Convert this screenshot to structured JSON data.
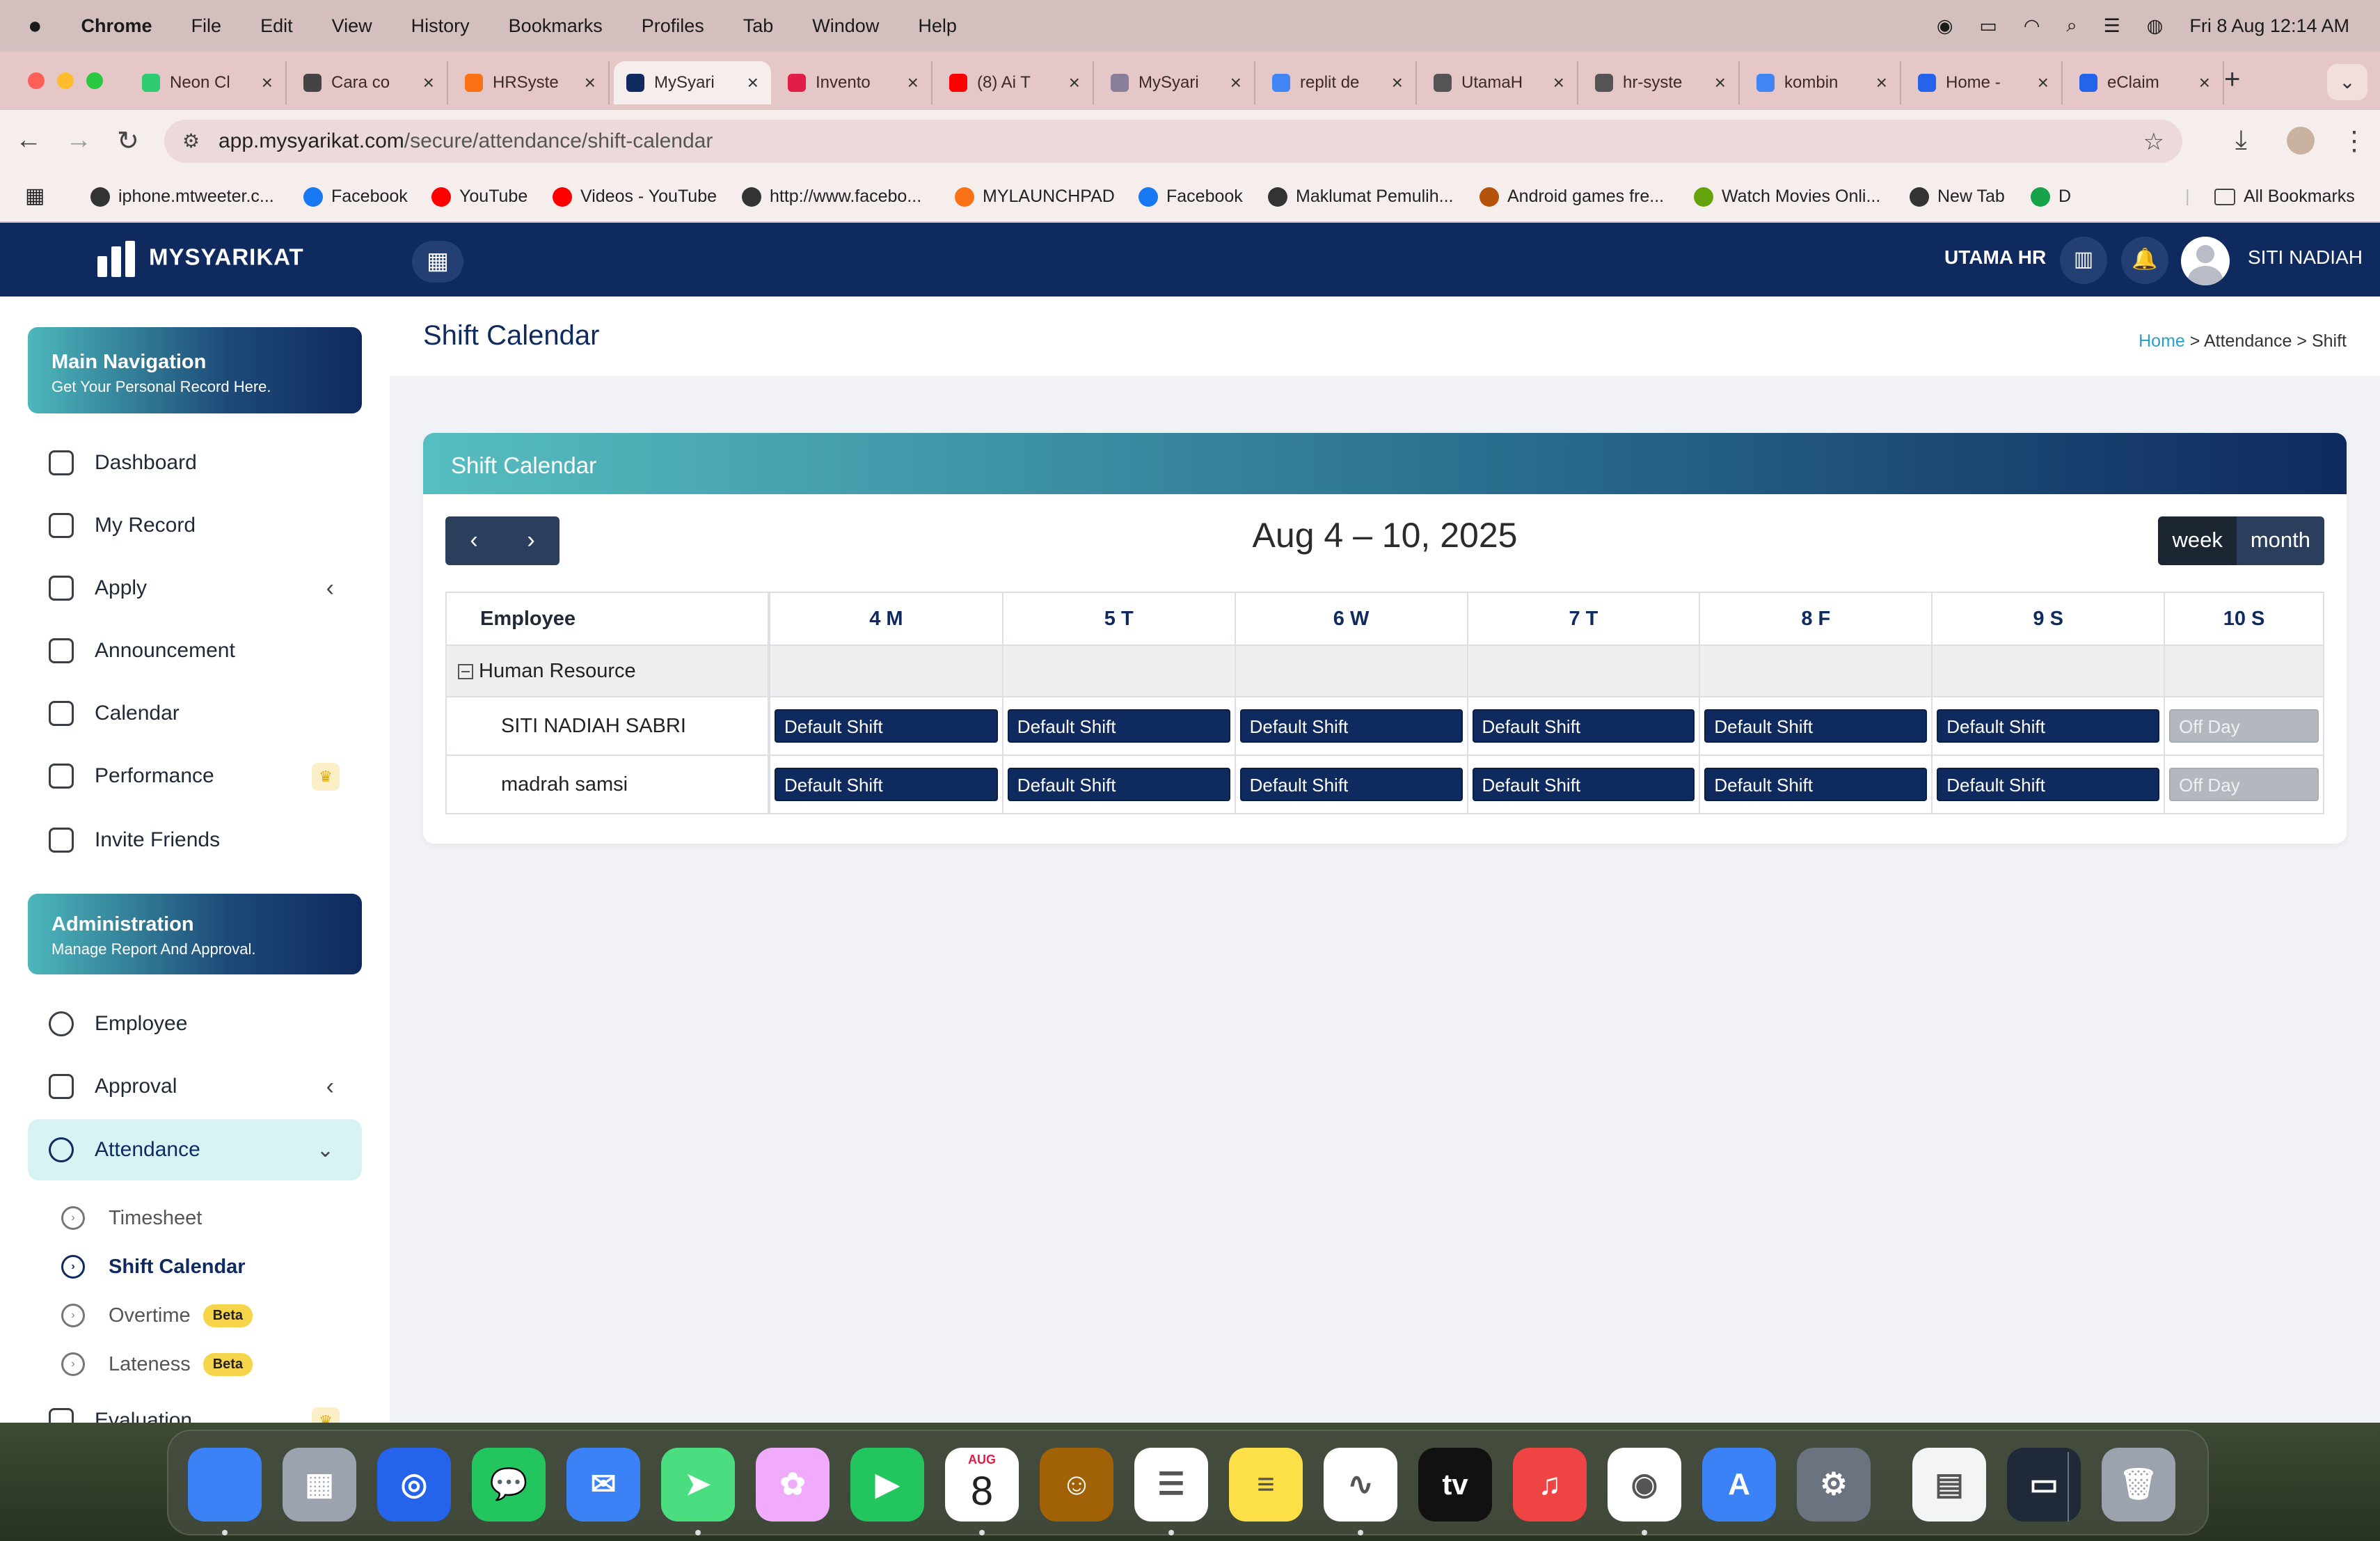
{
  "menubar": {
    "app": "Chrome",
    "items": [
      "File",
      "Edit",
      "View",
      "History",
      "Bookmarks",
      "Profiles",
      "Tab",
      "Window",
      "Help"
    ],
    "datetime": "Fri 8 Aug  12:14 AM"
  },
  "tabs": [
    {
      "title": "Neon Cl",
      "color": "#2ecc71"
    },
    {
      "title": "Cara co",
      "color": "#444444"
    },
    {
      "title": "HRSyste",
      "color": "#f97316"
    },
    {
      "title": "MySyari",
      "color": "#0f2a5e"
    },
    {
      "title": "Invento",
      "color": "#e11d48"
    },
    {
      "title": "(8) Ai T",
      "color": "#ff0000"
    },
    {
      "title": "MySyari",
      "color": "#8a7f9a"
    },
    {
      "title": "replit de",
      "color": "#4285f4"
    },
    {
      "title": "UtamaH",
      "color": "#555555"
    },
    {
      "title": "hr-syste",
      "color": "#555555"
    },
    {
      "title": "kombin",
      "color": "#4285f4"
    },
    {
      "title": "Home -",
      "color": "#2563eb"
    },
    {
      "title": "eClaim",
      "color": "#2563eb"
    }
  ],
  "address": {
    "host": "app.mysyarikat.com",
    "path": "/secure/attendance/shift-calendar"
  },
  "bookmarks": [
    {
      "label": "iphone.mtweeter.c...",
      "color": "#333333"
    },
    {
      "label": "Facebook",
      "color": "#1877f2"
    },
    {
      "label": "YouTube",
      "color": "#ff0000"
    },
    {
      "label": "Videos - YouTube",
      "color": "#ff0000"
    },
    {
      "label": "http://www.facebo...",
      "color": "#333333"
    },
    {
      "label": "MYLAUNCHPAD",
      "color": "#f97316"
    },
    {
      "label": "Facebook",
      "color": "#1877f2"
    },
    {
      "label": "Maklumat Pemulih...",
      "color": "#333333"
    },
    {
      "label": "Android games fre...",
      "color": "#b45309"
    },
    {
      "label": "Watch Movies Onli...",
      "color": "#65a30d"
    },
    {
      "label": "New Tab",
      "color": "#333333"
    },
    {
      "label": "D",
      "color": "#16a34a"
    }
  ],
  "bookmarks_all": "All Bookmarks",
  "header": {
    "brand": "MYSYARIKAT",
    "company": "UTAMA HR",
    "user": "SITI NADIAH"
  },
  "sidebar": {
    "main_card": {
      "title": "Main Navigation",
      "subtitle": "Get Your Personal Record Here."
    },
    "main_items": [
      "Dashboard",
      "My Record",
      "Apply",
      "Announcement",
      "Calendar",
      "Performance",
      "Invite Friends"
    ],
    "admin_card": {
      "title": "Administration",
      "subtitle": "Manage Report And Approval."
    },
    "admin_items": [
      "Employee",
      "Approval",
      "Attendance"
    ],
    "attendance_sub": [
      {
        "label": "Timesheet",
        "beta": ""
      },
      {
        "label": "Shift Calendar",
        "beta": ""
      },
      {
        "label": "Overtime",
        "beta": "Beta"
      },
      {
        "label": "Lateness",
        "beta": "Beta"
      }
    ],
    "next_item": "Evaluation"
  },
  "page": {
    "title": "Shift Calendar",
    "breadcrumb": {
      "home": "Home",
      "sep": ">",
      "section": "Attendance",
      "current": "Shift"
    }
  },
  "calendar": {
    "card_title": "Shift Calendar",
    "range": "Aug 4 – 10, 2025",
    "prev": "‹",
    "next": "›",
    "view_week": "week",
    "view_month": "month",
    "col_employee": "Employee",
    "days": [
      "4 M",
      "5 T",
      "6 W",
      "7 T",
      "8 F",
      "9 S",
      "10 S"
    ],
    "group": "Human Resource",
    "rows": [
      {
        "name": "SITI NADIAH SABRI",
        "shifts": [
          "Default Shift",
          "Default Shift",
          "Default Shift",
          "Default Shift",
          "Default Shift",
          "Default Shift",
          "Off Day"
        ]
      },
      {
        "name": "madrah samsi",
        "shifts": [
          "Default Shift",
          "Default Shift",
          "Default Shift",
          "Default Shift",
          "Default Shift",
          "Default Shift",
          "Off Day"
        ]
      }
    ]
  },
  "dock": {
    "calendar_month": "AUG",
    "calendar_day": "8",
    "tv_label": "tv",
    "apps": [
      {
        "name": "finder-icon",
        "color": "#3b82f6",
        "glyph": ""
      },
      {
        "name": "launchpad-icon",
        "color": "#9ca3af",
        "glyph": "▦"
      },
      {
        "name": "safari-icon",
        "color": "#2563eb",
        "glyph": "◎"
      },
      {
        "name": "messages-icon",
        "color": "#22c55e",
        "glyph": "💬"
      },
      {
        "name": "mail-icon",
        "color": "#3b82f6",
        "glyph": "✉"
      },
      {
        "name": "maps-icon",
        "color": "#4ade80",
        "glyph": "➤"
      },
      {
        "name": "photos-icon",
        "color": "#f0abfc",
        "glyph": "✿"
      },
      {
        "name": "facetime-icon",
        "color": "#22c55e",
        "glyph": "▶"
      },
      {
        "name": "calendar-icon",
        "color": "#ffffff",
        "glyph": ""
      },
      {
        "name": "contacts-icon",
        "color": "#a16207",
        "glyph": "☺"
      },
      {
        "name": "reminders-icon",
        "color": "#ffffff",
        "glyph": "☰"
      },
      {
        "name": "notes-icon",
        "color": "#fde047",
        "glyph": "≡"
      },
      {
        "name": "freeform-icon",
        "color": "#ffffff",
        "glyph": "∿"
      },
      {
        "name": "tv-icon",
        "color": "#111111",
        "glyph": ""
      },
      {
        "name": "music-icon",
        "color": "#ef4444",
        "glyph": "♫"
      },
      {
        "name": "chrome-icon",
        "color": "#ffffff",
        "glyph": "◉"
      },
      {
        "name": "app-store-icon",
        "color": "#3b82f6",
        "glyph": "A"
      },
      {
        "name": "system-settings-icon",
        "color": "#6b7280",
        "glyph": "⚙"
      },
      {
        "name": "document-preview-icon",
        "color": "#f3f4f6",
        "glyph": "▤"
      },
      {
        "name": "screenshot-preview-icon",
        "color": "#1f2937",
        "glyph": "▭"
      },
      {
        "name": "trash-icon",
        "color": "#9ca3af",
        "glyph": "🗑"
      }
    ]
  }
}
